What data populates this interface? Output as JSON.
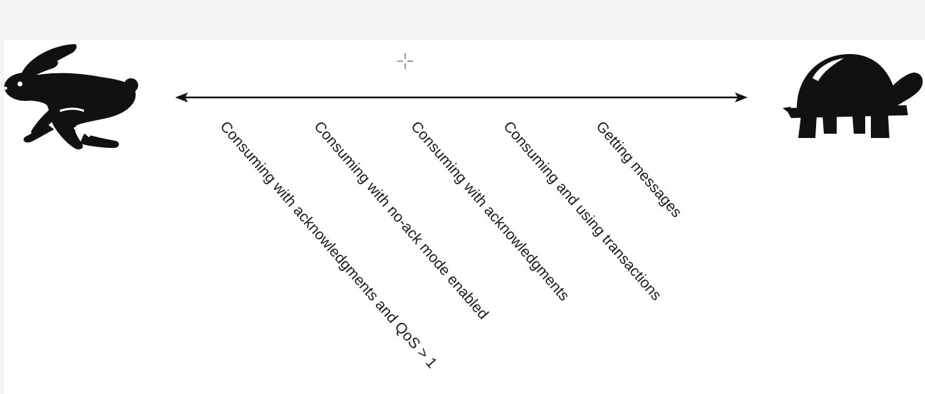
{
  "diagram": {
    "left_icon": "rabbit-icon",
    "right_icon": "turtle-icon",
    "cursor_icon": "crosshair-cursor-icon",
    "labels": [
      "Consuming with acknowledgments and QoS > 1",
      "Consuming with no-ack mode enabled",
      "Consuming with acknowledgments",
      "Consuming and using transactions",
      "Getting messages"
    ]
  },
  "colors": {
    "ink": "#111111",
    "background": "#ffffff",
    "strip": "#f4f4f6"
  }
}
